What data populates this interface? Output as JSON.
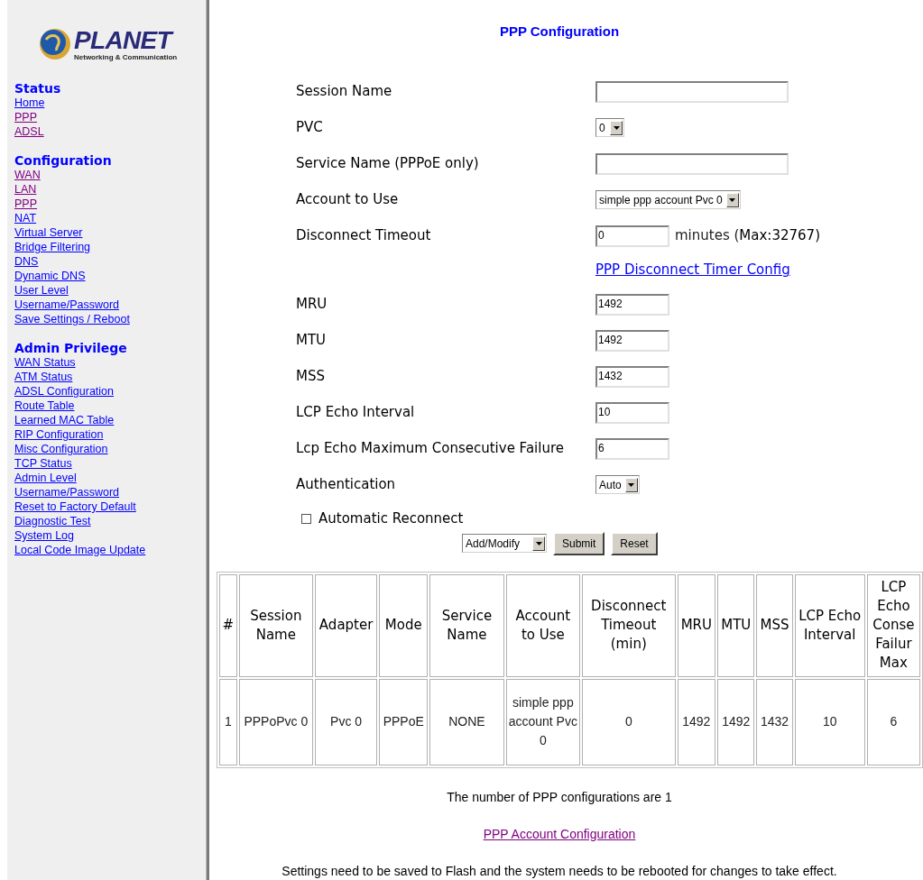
{
  "sidebar": {
    "logo": {
      "name": "PLANET",
      "tagline": "Networking & Communication"
    },
    "sections": [
      {
        "heading": "Status",
        "links": [
          {
            "label": "Home",
            "visited": false
          },
          {
            "label": "PPP",
            "visited": true
          },
          {
            "label": "ADSL",
            "visited": true
          }
        ]
      },
      {
        "heading": "Configuration",
        "links": [
          {
            "label": "WAN",
            "visited": true
          },
          {
            "label": "LAN",
            "visited": true
          },
          {
            "label": "PPP",
            "visited": true
          },
          {
            "label": "NAT",
            "visited": false
          },
          {
            "label": "Virtual Server",
            "visited": false
          },
          {
            "label": "Bridge Filtering",
            "visited": false
          },
          {
            "label": "DNS",
            "visited": false
          },
          {
            "label": "Dynamic DNS",
            "visited": false
          },
          {
            "label": "User Level",
            "visited": false
          },
          {
            "label": "Username/Password",
            "visited": false
          },
          {
            "label": "Save Settings / Reboot",
            "visited": false
          }
        ]
      },
      {
        "heading": "Admin Privilege",
        "links": [
          {
            "label": "WAN Status",
            "visited": false
          },
          {
            "label": "ATM Status",
            "visited": false
          },
          {
            "label": "ADSL Configuration",
            "visited": false
          },
          {
            "label": "Route Table",
            "visited": false
          },
          {
            "label": "Learned MAC Table",
            "visited": false
          },
          {
            "label": "RIP Configuration",
            "visited": false
          },
          {
            "label": "Misc Configuration",
            "visited": false
          },
          {
            "label": "TCP Status",
            "visited": false
          },
          {
            "label": "Admin Level",
            "visited": false
          },
          {
            "label": "Username/Password",
            "visited": false
          },
          {
            "label": "Reset to Factory Default",
            "visited": false
          },
          {
            "label": "Diagnostic Test",
            "visited": false
          },
          {
            "label": "System Log",
            "visited": false
          },
          {
            "label": "Local Code Image Update",
            "visited": false
          }
        ]
      }
    ]
  },
  "page_title": "PPP Configuration",
  "form": [
    {
      "kind": "text",
      "label": "Session Name"
    },
    {
      "kind": "select",
      "label": "PVC",
      "value": "0"
    },
    {
      "kind": "text",
      "label": "Service Name (PPPoE only)"
    },
    {
      "kind": "select",
      "label": "Account to Use",
      "value": "simple ppp account Pvc 0"
    },
    {
      "kind": "number",
      "label": "Disconnect Timeout",
      "value": "0",
      "suffix": "minutes (",
      "suffix_strong": "Max:32767)"
    },
    {
      "kind": "link",
      "label": "PPP Disconnect Timer Config",
      "visited": false
    },
    {
      "kind": "number",
      "label": "MRU",
      "value": "1492"
    },
    {
      "kind": "number",
      "label": "MTU",
      "value": "1492"
    },
    {
      "kind": "number",
      "label": "MSS",
      "value": "1432"
    },
    {
      "kind": "number",
      "label": "LCP Echo Interval",
      "value": "10"
    },
    {
      "kind": "number",
      "label": "Lcp Echo Maximum Consecutive Failure",
      "value": "6"
    },
    {
      "kind": "select",
      "label": "Authentication",
      "value": "Auto"
    },
    {
      "kind": "checkbox",
      "label": "Automatic Reconnect",
      "checked": false
    }
  ],
  "actions": {
    "mode": "Add/Modify",
    "buttons": [
      "Submit",
      "Reset"
    ]
  },
  "table": {
    "columns": [
      "#",
      "Session Name",
      "Adapter",
      "Mode",
      "Service Name",
      "Account to Use",
      "Disconnect Timeout (min)",
      "MRU",
      "MTU",
      "MSS",
      "LCP Echo Interval",
      "LCP Echo Conse Failur Max"
    ],
    "rows": [
      [
        "1",
        "PPPoPvc 0",
        "Pvc 0",
        "PPPoE",
        "NONE",
        "simple ppp account Pvc 0",
        "0",
        "1492",
        "1492",
        "1432",
        "10",
        "6"
      ]
    ]
  },
  "summary": "The number of PPP configurations are 1",
  "account_link": {
    "label": "PPP Account Configuration",
    "visited": true
  },
  "note": "Settings need to be saved to Flash and the system needs to be rebooted for changes to take effect."
}
